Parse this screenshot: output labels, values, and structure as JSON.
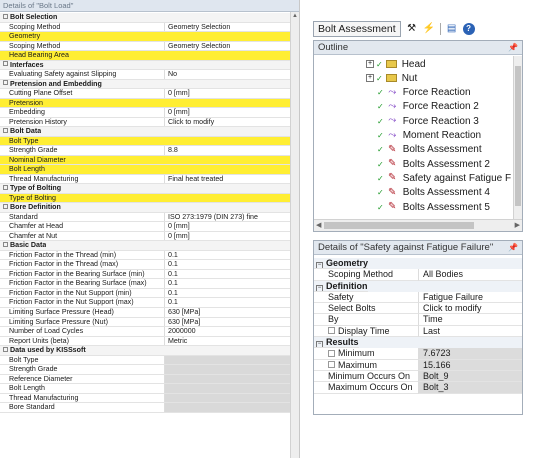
{
  "left_panel": {
    "title": "Details of \"Bolt Load\"",
    "rows": [
      {
        "type": "section",
        "label": "Bolt Selection"
      },
      {
        "type": "row",
        "key": "Scoping Method",
        "value": "Geometry Selection"
      },
      {
        "type": "highlight",
        "key": "Geometry",
        "value": ""
      },
      {
        "type": "row",
        "key": "Scoping Method",
        "value": "Geometry Selection"
      },
      {
        "type": "highlight",
        "key": "Head Bearing Area",
        "value": ""
      },
      {
        "type": "section",
        "label": "Interfaces"
      },
      {
        "type": "row",
        "key": "Evaluating Safety against Slipping",
        "value": "No"
      },
      {
        "type": "section",
        "label": "Pretension and Embedding"
      },
      {
        "type": "row",
        "key": "Cutting Plane Offset",
        "value": "0 [mm]"
      },
      {
        "type": "highlight",
        "key": "Pretension",
        "value": ""
      },
      {
        "type": "row",
        "key": "Embedding",
        "value": "0 [mm]"
      },
      {
        "type": "row",
        "key": "Pretension History",
        "value": "Click to modify"
      },
      {
        "type": "section",
        "label": "Bolt Data"
      },
      {
        "type": "highlight",
        "key": "Bolt Type",
        "value": ""
      },
      {
        "type": "row",
        "key": "Strength Grade",
        "value": "8.8"
      },
      {
        "type": "highlight",
        "key": "Nominal Diameter",
        "value": ""
      },
      {
        "type": "highlight",
        "key": "Bolt Length",
        "value": ""
      },
      {
        "type": "row",
        "key": "Thread Manufacturing",
        "value": "Final heat treated"
      },
      {
        "type": "section",
        "label": "Type of Bolting"
      },
      {
        "type": "highlight",
        "key": "Type of Bolting",
        "value": ""
      },
      {
        "type": "section",
        "label": "Bore Definition"
      },
      {
        "type": "row",
        "key": "Standard",
        "value": "ISO 273:1979 (DIN 273) fine"
      },
      {
        "type": "row",
        "key": "Chamfer at Head",
        "value": "0 [mm]"
      },
      {
        "type": "row",
        "key": "Chamfer at Nut",
        "value": "0 [mm]"
      },
      {
        "type": "section",
        "label": "Basic Data"
      },
      {
        "type": "row",
        "key": "Friction Factor in the Thread (min)",
        "value": "0.1"
      },
      {
        "type": "row",
        "key": "Friction Factor in the Thread (max)",
        "value": "0.1"
      },
      {
        "type": "row",
        "key": "Friction Factor in the Bearing Surface (min)",
        "value": "0.1"
      },
      {
        "type": "row",
        "key": "Friction Factor in the Bearing Surface (max)",
        "value": "0.1"
      },
      {
        "type": "row",
        "key": "Friction Factor in the Nut Support (min)",
        "value": "0.1"
      },
      {
        "type": "row",
        "key": "Friction Factor in the Nut Support (max)",
        "value": "0.1"
      },
      {
        "type": "row",
        "key": "Limiting Surface Pressure (Head)",
        "value": "630 [MPa]"
      },
      {
        "type": "row",
        "key": "Limiting Surface Pressure (Nut)",
        "value": "630 [MPa]"
      },
      {
        "type": "row",
        "key": "Number of Load Cycles",
        "value": "2000000"
      },
      {
        "type": "row",
        "key": "Report Units (beta)",
        "value": "Metric"
      },
      {
        "type": "section",
        "label": "Data used by KISSsoft"
      },
      {
        "type": "gray",
        "key": "Bolt Type",
        "value": ""
      },
      {
        "type": "gray",
        "key": "Strength Grade",
        "value": ""
      },
      {
        "type": "gray",
        "key": "Reference Diameter",
        "value": ""
      },
      {
        "type": "gray",
        "key": "Bolt Length",
        "value": ""
      },
      {
        "type": "gray",
        "key": "Thread Manufacturing",
        "value": ""
      },
      {
        "type": "gray",
        "key": "Bore Standard",
        "value": ""
      }
    ]
  },
  "toolbar": {
    "label": "Bolt Assessment",
    "icons": [
      "wrench-icon",
      "lightning-icon",
      "chart-icon",
      "help-icon"
    ]
  },
  "outline": {
    "title": "Outline",
    "pin": "\u0002",
    "nodes": [
      {
        "label": "Head",
        "icon": "folder",
        "expander": "+",
        "indent": 1
      },
      {
        "label": "Nut",
        "icon": "folder",
        "expander": "+",
        "indent": 1
      },
      {
        "label": "Force Reaction",
        "icon": "force",
        "indent": 2
      },
      {
        "label": "Force Reaction 2",
        "icon": "force",
        "indent": 2
      },
      {
        "label": "Force Reaction 3",
        "icon": "force",
        "indent": 2
      },
      {
        "label": "Moment Reaction",
        "icon": "force",
        "indent": 2
      },
      {
        "label": "Bolts Assessment",
        "icon": "bolt",
        "indent": 2
      },
      {
        "label": "Bolts Assessment 2",
        "icon": "bolt",
        "indent": 2
      },
      {
        "label": "Safety against Fatigue F",
        "icon": "bolt",
        "indent": 2
      },
      {
        "label": "Bolts Assessment 4",
        "icon": "bolt",
        "indent": 2
      },
      {
        "label": "Bolts Assessment 5",
        "icon": "bolt",
        "indent": 2
      }
    ]
  },
  "details": {
    "title": "Details of \"Safety against Fatigue Failure\"",
    "rows": [
      {
        "type": "section",
        "label": "Geometry"
      },
      {
        "type": "row",
        "key": "Scoping Method",
        "value": "All Bodies"
      },
      {
        "type": "section",
        "label": "Definition"
      },
      {
        "type": "row",
        "key": "Safety",
        "value": "Fatigue Failure"
      },
      {
        "type": "row",
        "key": "Select Bolts",
        "value": "Click to modify"
      },
      {
        "type": "row",
        "key": "By",
        "value": "Time"
      },
      {
        "type": "check",
        "key": "Display Time",
        "value": "Last"
      },
      {
        "type": "section",
        "label": "Results"
      },
      {
        "type": "checkgray",
        "key": "Minimum",
        "value": "7.6723"
      },
      {
        "type": "checkgray",
        "key": "Maximum",
        "value": "15.166"
      },
      {
        "type": "gray",
        "key": "Minimum Occurs On",
        "value": "Bolt_9"
      },
      {
        "type": "gray",
        "key": "Maximum Occurs On",
        "value": "Bolt_3"
      }
    ]
  },
  "colors": {
    "highlight": "#ffee33",
    "header": "#e2e8ef",
    "bolt_icon": "#b0202a",
    "force_icon": "#7a3ac2"
  }
}
